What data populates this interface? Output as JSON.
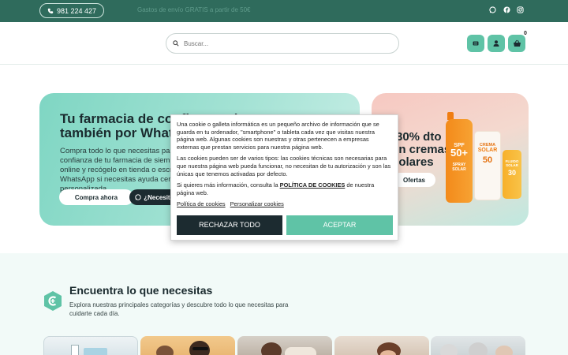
{
  "topbar": {
    "phone": "981 224 427",
    "promo": "Gastos de envío GRATIS a partir de 50€",
    "social_icons": [
      "whatsapp-icon",
      "facebook-icon",
      "instagram-icon"
    ]
  },
  "header": {
    "search_placeholder": "Buscar...",
    "cart_count": "0"
  },
  "hero": {
    "title": "Tu farmacia de confianza, ahora también por WhatsApp",
    "text": "Compra todo lo que necesitas para tu salud con la confianza de tu farmacia de siempre. Haz tu pedido online y recógelo en tienda o escríbenos por WhatsApp si necesitas ayuda cercana y personalizada.",
    "btn_buy": "Compra ahora",
    "btn_whatsapp": "¿Necesitas ayuda?"
  },
  "promo_card": {
    "title": "-30% dto en cremas solares",
    "btn": "Ofertas",
    "products": [
      {
        "line1": "SPF",
        "line2": "50+",
        "line3": "SPRAY SOLAR"
      },
      {
        "line1": "CREMA",
        "line2": "SOLAR",
        "line3": "50"
      },
      {
        "line1": "FLUIDO",
        "line2": "SOLAR",
        "line3": "30"
      }
    ]
  },
  "section": {
    "title": "Encuentra lo que necesitas",
    "text": "Explora nuestras principales categorías y descubre todo lo que necesitas para cuidarte cada día."
  },
  "cookie": {
    "p1": "Una cookie o galleta informática es un pequeño archivo de información que se guarda en tu ordenador, \"smartphone\" o tableta cada vez que visitas nuestra página web. Algunas cookies son nuestras y otras pertenecen a empresas externas que prestan servicios para nuestra página web.",
    "p2": "Las cookies pueden ser de varios tipos: las cookies técnicas son necesarias para que nuestra página web pueda funcionar, no necesitan de tu autorización y son las únicas que tenemos activadas por defecto.",
    "p3_before": "Si quieres más información, consulta la ",
    "p3_link": "POLÍTICA DE COOKIES",
    "p3_after": " de nuestra página web.",
    "link_policy": "Política de cookies",
    "link_customize": "Personalizar cookies",
    "btn_reject": "RECHAZAR TODO",
    "btn_accept": "ACEPTAR"
  },
  "colors": {
    "topbar": "#2f6b5c",
    "accent": "#5fc3a6",
    "dark": "#1c2b30"
  }
}
